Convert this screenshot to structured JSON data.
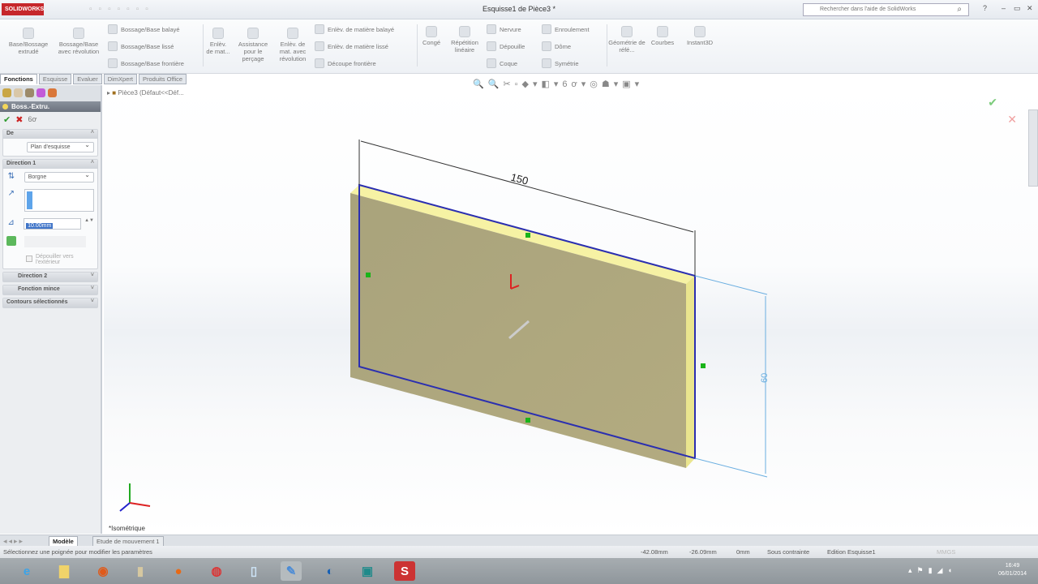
{
  "app": {
    "logo": "SOLIDWORKS",
    "title": "Esquisse1 de Pièce3 *",
    "search_placeholder": "Rechercher dans l'aide de SolidWorks"
  },
  "ribbon": {
    "large": [
      "Base/Bossage extrudé",
      "Bossage/Base avec révolution",
      "Enlèv. de mat...",
      "Assistance pour le perçage",
      "Enlèv. de mat. avec révolution",
      "Congé",
      "Répétition linéaire",
      "Géométrie de réfé...",
      "Courbes",
      "Instant3D"
    ],
    "small": [
      "Bossage/Base balayé",
      "Bossage/Base lissé",
      "Bossage/Base frontière",
      "Enlèv. de matière balayé",
      "Enlèv. de matière lissé",
      "Découpe frontière",
      "Nervure",
      "Dépouille",
      "Coque",
      "Enroulement",
      "Dôme",
      "Symétrie"
    ]
  },
  "tabs": [
    "Fonctions",
    "Esquisse",
    "Evaluer",
    "DimXpert",
    "Produits Office"
  ],
  "panel": {
    "title": "Boss.-Extru.",
    "from_label": "De",
    "from_value": "Plan d'esquisse",
    "dir1_label": "Direction 1",
    "dir1_type": "Borgne",
    "depth_value": "10.00mm",
    "draft_outward": "Dépouiller vers l'extérieur",
    "dir2_label": "Direction 2",
    "thin_label": "Fonction mince",
    "contours_label": "Contours sélectionnés"
  },
  "viewport": {
    "breadcrumb": "Pièce3 (Défaut<<Déf...",
    "dim_width": "150",
    "dim_height": "60",
    "view_name": "*Isométrique"
  },
  "bottom_tabs": [
    "Modèle",
    "Etude de mouvement 1"
  ],
  "status": {
    "message": "Sélectionnez une poignée pour modifier les paramètres",
    "x": "-42.08mm",
    "y": "-26.09mm",
    "z": "0mm",
    "state": "Sous contrainte",
    "mode": "Edition Esquisse1",
    "units": "MMGS"
  },
  "taskbar": {
    "time": "16:49",
    "date": "06/01/2014"
  },
  "colors": {
    "face": "#a8a27b",
    "edge": "#f6f2a0",
    "sketch": "#2b2fb0",
    "dimension": "#6aaee0",
    "accent": "#c6272b"
  }
}
